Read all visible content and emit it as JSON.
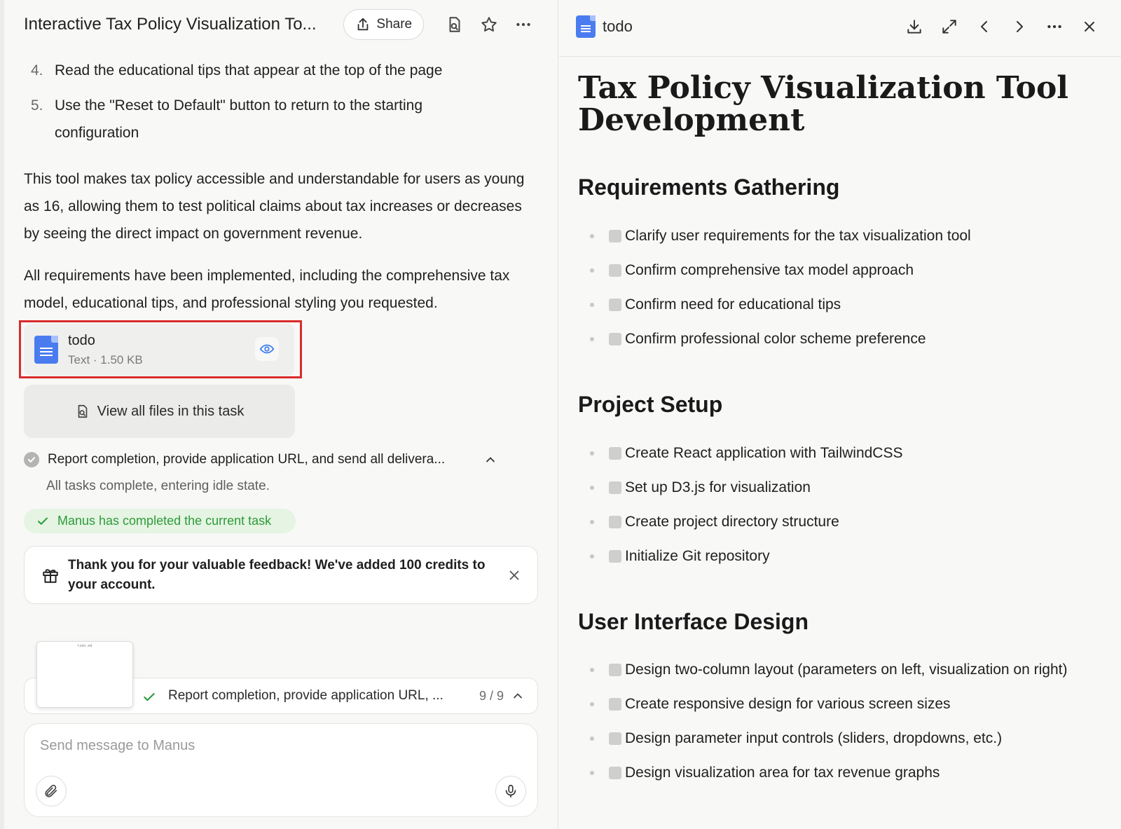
{
  "left": {
    "header": {
      "title": "Interactive Tax Policy Visualization To...",
      "share_label": "Share",
      "icons": [
        "file-icon",
        "star-icon",
        "more-icon"
      ]
    },
    "steps": [
      {
        "num": "4.",
        "text": "Read the educational tips that appear at the top of the page"
      },
      {
        "num": "5.",
        "text": "Use the \"Reset to Default\" button to return to the starting configuration"
      }
    ],
    "paragraphs": [
      "This tool makes tax policy accessible and understandable for users as young as 16, allowing them to test political claims about tax increases or decreases by seeing the direct impact on government revenue.",
      "All requirements have been implemented, including the comprehensive tax model, educational tips, and professional styling you requested."
    ],
    "file": {
      "name": "todo",
      "meta": "Text · 1.50 KB"
    },
    "view_all_label": "View all files in this task",
    "report": {
      "title": "Report completion, provide application URL, and send all delivera...",
      "detail": "All tasks complete, entering idle state."
    },
    "completed_label": "Manus has completed the current task",
    "feedback_text": "Thank you for your valuable feedback! We've added 100 credits to your account.",
    "progress": {
      "text": "Report completion, provide application URL, ...",
      "count": "9 / 9",
      "thumb_title": "todo.md"
    },
    "composer": {
      "placeholder": "Send message to Manus"
    }
  },
  "right": {
    "header_title": "todo",
    "doc_title": "Tax Policy Visualization Tool Development",
    "sections": [
      {
        "heading": "Requirements Gathering",
        "items": [
          "Clarify user requirements for the tax visualization tool",
          "Confirm comprehensive tax model approach",
          "Confirm need for educational tips",
          "Confirm professional color scheme preference"
        ]
      },
      {
        "heading": "Project Setup",
        "items": [
          "Create React application with TailwindCSS",
          "Set up D3.js for visualization",
          "Create project directory structure",
          "Initialize Git repository"
        ]
      },
      {
        "heading": "User Interface Design",
        "items": [
          "Design two-column layout (parameters on left, visualization on right)",
          "Create responsive design for various screen sizes",
          "Design parameter input controls (sliders, dropdowns, etc.)",
          "Design visualization area for tax revenue graphs"
        ]
      }
    ]
  },
  "colors": {
    "highlight_border": "#d92b2b",
    "doc_icon_blue": "#4a7cf0",
    "success_green": "#2e9b3a",
    "success_bg": "#e5f4e3"
  }
}
